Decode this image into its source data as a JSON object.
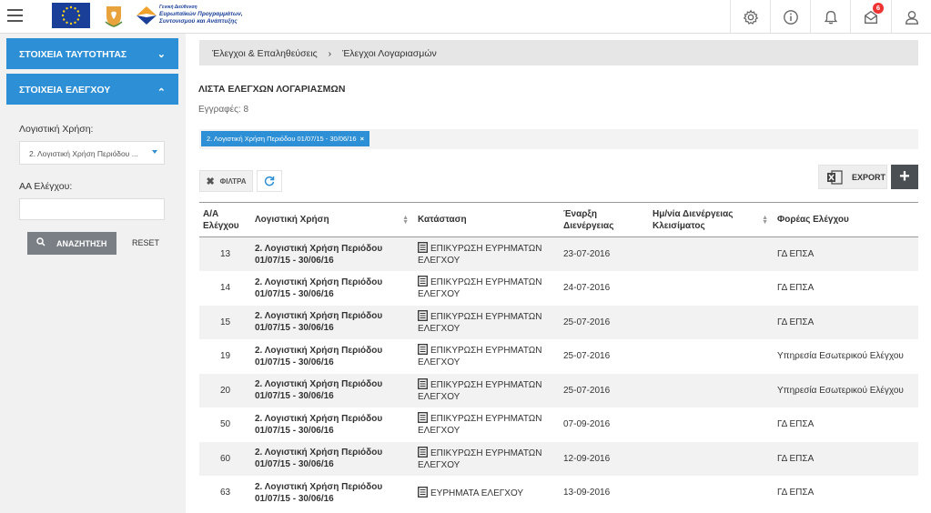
{
  "header": {
    "logo_lines": [
      "Γενική Διεύθυνση",
      "Ευρωπαϊκών Προγραμμάτων,",
      "Συντονισμού και Ανάπτυξης"
    ],
    "notification_count": "6"
  },
  "sidebar": {
    "section_identity": "ΣΤΟΙΧΕΙΑ ΤΑΥΤΟΤΗΤΑΣ",
    "section_control": "ΣΤΟΙΧΕΙΑ ΕΛΕΓΧΟΥ",
    "fiscal_year_label": "Λογιστική Χρήση:",
    "fiscal_year_value": "2. Λογιστική Χρήση Περιόδου ...",
    "control_no_label": "ΑΑ Ελέγχου:",
    "control_no_value": "",
    "search_label": "ΑΝΑΖΗΤΗΣΗ",
    "reset_label": "RESET"
  },
  "breadcrumb": [
    "Έλεγχοι & Επαληθεύσεις",
    "Έλεγχοι Λογαριασμών"
  ],
  "page_title": "ΛΙΣΤΑ ΕΛΕΓΧΩΝ ΛΟΓΑΡΙΑΣΜΩΝ",
  "records_text": "Εγγραφές: 8",
  "filter_chip": "2. Λογιστική Χρήση Περιόδου 01/07/15 - 30/06/16",
  "toolbar": {
    "filters_label": "ΦΙΛΤΡΑ",
    "export_label": "EXPORT",
    "add_label": "+"
  },
  "table": {
    "headers": [
      "Α/Α Ελέγχου",
      "Λογιστική Χρήση",
      "Κατάσταση",
      "Έναρξη Διενέργειας",
      "Ημ/νία Διενέργειας Κλεισίματος",
      "Φορέας Ελέγχου"
    ],
    "rows": [
      {
        "id": "13",
        "period": "2. Λογιστική Χρήση Περιόδου 01/07/15 - 30/06/16",
        "status": "ΕΠΙΚΥΡΩΣΗ ΕΥΡΗΜΑΤΩΝ ΕΛΕΓΧΟΥ",
        "start": "23-07-2016",
        "close": "",
        "body": "ΓΔ ΕΠΣΑ"
      },
      {
        "id": "14",
        "period": "2. Λογιστική Χρήση Περιόδου 01/07/15 - 30/06/16",
        "status": "ΕΠΙΚΥΡΩΣΗ ΕΥΡΗΜΑΤΩΝ ΕΛΕΓΧΟΥ",
        "start": "24-07-2016",
        "close": "",
        "body": "ΓΔ ΕΠΣΑ"
      },
      {
        "id": "15",
        "period": "2. Λογιστική Χρήση Περιόδου 01/07/15 - 30/06/16",
        "status": "ΕΠΙΚΥΡΩΣΗ ΕΥΡΗΜΑΤΩΝ ΕΛΕΓΧΟΥ",
        "start": "25-07-2016",
        "close": "",
        "body": "ΓΔ ΕΠΣΑ"
      },
      {
        "id": "19",
        "period": "2. Λογιστική Χρήση Περιόδου 01/07/15 - 30/06/16",
        "status": "ΕΠΙΚΥΡΩΣΗ ΕΥΡΗΜΑΤΩΝ ΕΛΕΓΧΟΥ",
        "start": "25-07-2016",
        "close": "",
        "body": "Υπηρεσία Εσωτερικού Ελέγχου"
      },
      {
        "id": "20",
        "period": "2. Λογιστική Χρήση Περιόδου 01/07/15 - 30/06/16",
        "status": "ΕΠΙΚΥΡΩΣΗ ΕΥΡΗΜΑΤΩΝ ΕΛΕΓΧΟΥ",
        "start": "25-07-2016",
        "close": "",
        "body": "Υπηρεσία Εσωτερικού Ελέγχου"
      },
      {
        "id": "50",
        "period": "2. Λογιστική Χρήση Περιόδου 01/07/15 - 30/06/16",
        "status": "ΕΠΙΚΥΡΩΣΗ ΕΥΡΗΜΑΤΩΝ ΕΛΕΓΧΟΥ",
        "start": "07-09-2016",
        "close": "",
        "body": "ΓΔ ΕΠΣΑ"
      },
      {
        "id": "60",
        "period": "2. Λογιστική Χρήση Περιόδου 01/07/15 - 30/06/16",
        "status": "ΕΠΙΚΥΡΩΣΗ ΕΥΡΗΜΑΤΩΝ ΕΛΕΓΧΟΥ",
        "start": "12-09-2016",
        "close": "",
        "body": "ΓΔ ΕΠΣΑ"
      },
      {
        "id": "63",
        "period": "2. Λογιστική Χρήση Περιόδου 01/07/15 - 30/06/16",
        "status": "ΕΥΡΗΜΑΤΑ ΕΛΕΓΧΟΥ",
        "start": "13-09-2016",
        "close": "",
        "body": "ΓΔ ΕΠΣΑ"
      }
    ]
  }
}
